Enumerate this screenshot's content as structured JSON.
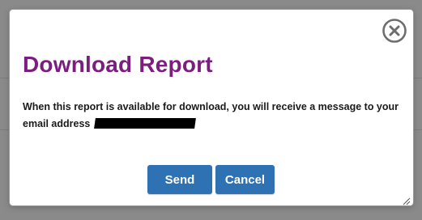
{
  "dialog": {
    "title": "Download Report",
    "message": "When this report is available for download, you will receive a message to your email address",
    "send_label": "Send",
    "cancel_label": "Cancel"
  },
  "colors": {
    "title": "#7a1f7e",
    "button": "#2f72b4",
    "overlay": "#8a8a8a"
  },
  "icons": {
    "close": "close-circle-icon",
    "resize": "resize-grip-icon"
  }
}
